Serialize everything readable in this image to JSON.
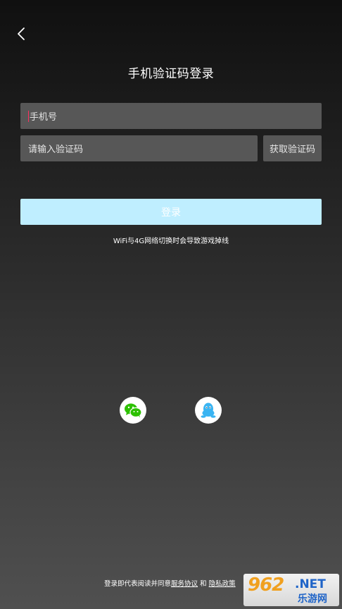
{
  "header": {
    "back_icon": "chevron-left-icon",
    "title": "手机验证码登录"
  },
  "form": {
    "phone_placeholder": "手机号",
    "code_placeholder": "请输入验证码",
    "get_code_label": "获取验证码",
    "login_label": "登录"
  },
  "tip": "WiFi与4G网络切换时会导致游戏掉线",
  "social": {
    "wechat_icon": "wechat-icon",
    "qq_icon": "qq-icon"
  },
  "agreement": {
    "prefix": "登录即代表阅读并同意",
    "service_link": "服务协议",
    "conjunction": "和",
    "privacy_link": "隐私政策"
  },
  "watermark": {
    "number": "962",
    "domain": ".NET",
    "name": "乐游网"
  },
  "colors": {
    "login_button": "#bfeeff",
    "input_background": "#575757",
    "wechat": "#2dc100",
    "qq": "#3ab4f2",
    "caret": "#ff3060"
  }
}
